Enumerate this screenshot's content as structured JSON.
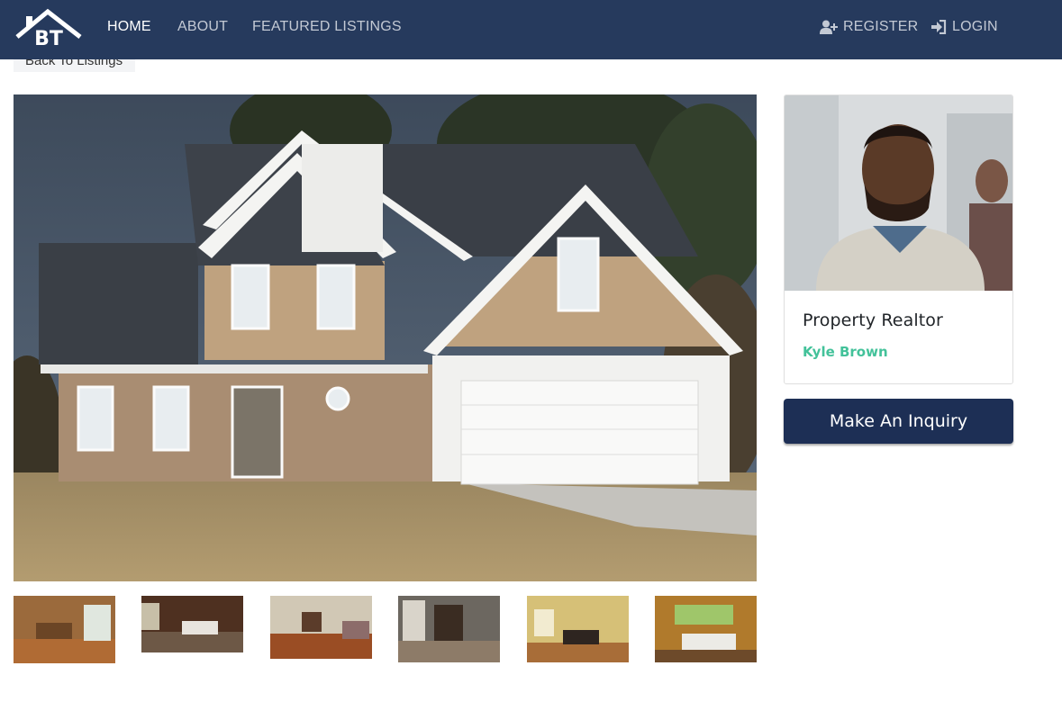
{
  "navbar": {
    "logo_text": "BT",
    "links": [
      {
        "label": "HOME",
        "active": true
      },
      {
        "label": "ABOUT",
        "active": false
      },
      {
        "label": "FEATURED LISTINGS",
        "active": false
      }
    ],
    "register_label": "REGISTER",
    "login_label": "LOGIN",
    "background_color": "#263a5d"
  },
  "back_button": {
    "label": "Back To Listings"
  },
  "listing": {
    "main_image_alt": "house-exterior",
    "thumbnails": [
      "kitchen",
      "living-room",
      "family-room",
      "dining-room",
      "billiard-room",
      "sunroom"
    ]
  },
  "realtor": {
    "title": "Property Realtor",
    "name": "Kyle Brown",
    "name_color": "#43c29a"
  },
  "inquiry_button": {
    "label": "Make An Inquiry",
    "color": "#1d2f55"
  }
}
